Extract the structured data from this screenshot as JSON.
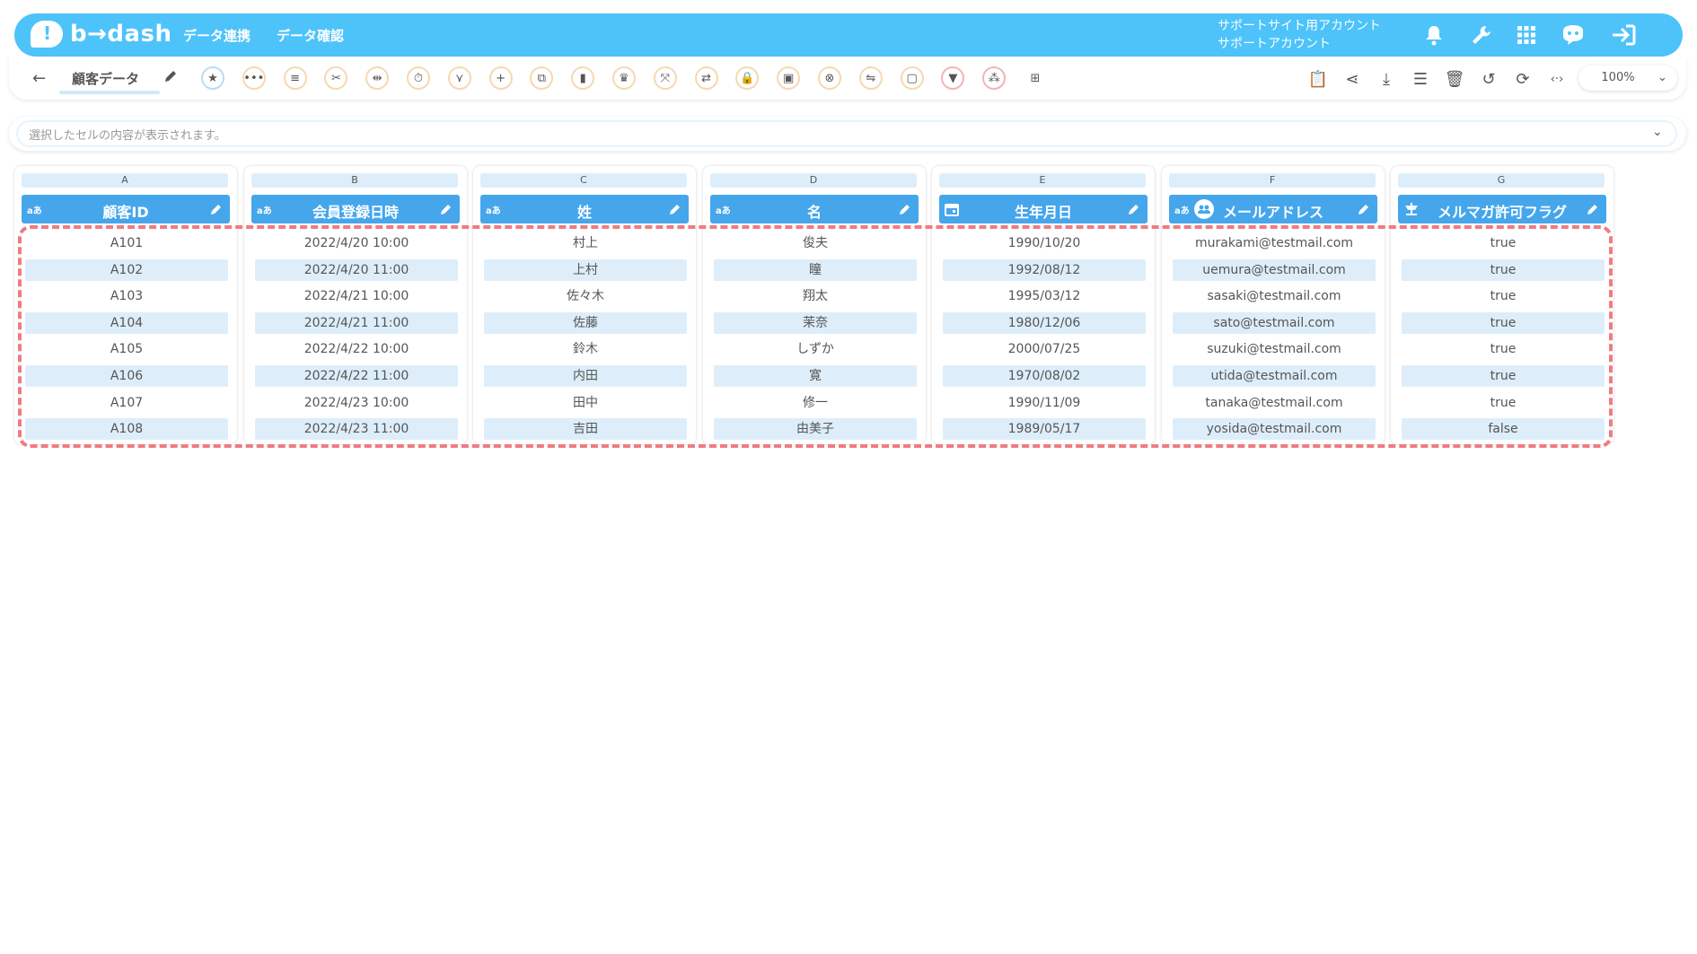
{
  "header": {
    "brand": "b→dash",
    "logo_mark": "!",
    "nav": [
      "データ連携",
      "データ確認"
    ],
    "account_line1": "サポートサイト用アカウント",
    "account_line2": "サポートアカウント",
    "icons": [
      "bell-icon",
      "wrench-icon",
      "apps-grid-icon",
      "chat-bot-icon",
      "logout-icon"
    ]
  },
  "toolbar": {
    "back_icon": "←",
    "sheet_name": "顧客データ",
    "tools": [
      {
        "name": "favorite-star-icon",
        "glyph": "★",
        "style": "blue"
      },
      {
        "name": "more-icon",
        "glyph": "•••",
        "style": "orange"
      },
      {
        "name": "rows-icon",
        "glyph": "≡",
        "style": "orange"
      },
      {
        "name": "split-icon",
        "glyph": "✂",
        "style": "orange"
      },
      {
        "name": "remove-column-icon",
        "glyph": "⇹",
        "style": "orange"
      },
      {
        "name": "timer-icon",
        "glyph": "⏱",
        "style": "orange"
      },
      {
        "name": "merge-icon",
        "glyph": "⋎",
        "style": "orange"
      },
      {
        "name": "add-icon",
        "glyph": "+",
        "style": "orange"
      },
      {
        "name": "copy-icon",
        "glyph": "⧉",
        "style": "orange"
      },
      {
        "name": "delete-icon",
        "glyph": "▮",
        "style": "orange"
      },
      {
        "name": "crown-icon",
        "glyph": "♛",
        "style": "orange"
      },
      {
        "name": "collapse-icon",
        "glyph": "⤧",
        "style": "orange"
      },
      {
        "name": "convert-icon",
        "glyph": "⇄",
        "style": "orange"
      },
      {
        "name": "lock-icon",
        "glyph": "🔒",
        "style": "orange"
      },
      {
        "name": "box-icon",
        "glyph": "▣",
        "style": "orange"
      },
      {
        "name": "cancel-icon",
        "glyph": "⊗",
        "style": "orange"
      },
      {
        "name": "translate-icon",
        "glyph": "⇋",
        "style": "orange"
      },
      {
        "name": "frame-icon",
        "glyph": "▢",
        "style": "orange"
      },
      {
        "name": "filter-icon",
        "glyph": "▼",
        "style": "red"
      },
      {
        "name": "pivot-icon",
        "glyph": "⁂",
        "style": "red"
      },
      {
        "name": "table-icon",
        "glyph": "⊞",
        "style": "plain"
      }
    ],
    "right_icons": [
      {
        "name": "clipboard-icon",
        "glyph": "📋"
      },
      {
        "name": "share-icon",
        "glyph": "⋖"
      },
      {
        "name": "download-icon",
        "glyph": "⤓"
      },
      {
        "name": "list-view-icon",
        "glyph": "☰"
      },
      {
        "name": "trash-icon",
        "glyph": "🗑"
      },
      {
        "name": "history-icon",
        "glyph": "↺"
      },
      {
        "name": "refresh-icon",
        "glyph": "⟳"
      },
      {
        "name": "code-icon",
        "glyph": "‹·›"
      }
    ],
    "zoom": "100%"
  },
  "cellbar": {
    "placeholder": "選択したセルの内容が表示されます。",
    "chevron": "⌄"
  },
  "columns": [
    {
      "letter": "A",
      "type": "aあ",
      "name": "顧客ID",
      "cells": [
        "A101",
        "A102",
        "A103",
        "A104",
        "A105",
        "A106",
        "A107",
        "A108"
      ]
    },
    {
      "letter": "B",
      "type": "aあ",
      "name": "会員登録日時",
      "cells": [
        "2022/4/20 10:00",
        "2022/4/20 11:00",
        "2022/4/21 10:00",
        "2022/4/21 11:00",
        "2022/4/22 10:00",
        "2022/4/22 11:00",
        "2022/4/23 10:00",
        "2022/4/23 11:00"
      ]
    },
    {
      "letter": "C",
      "type": "aあ",
      "name": "姓",
      "cells": [
        "村上",
        "上村",
        "佐々木",
        "佐藤",
        "鈴木",
        "内田",
        "田中",
        "吉田"
      ]
    },
    {
      "letter": "D",
      "type": "aあ",
      "name": "名",
      "cells": [
        "俊夫",
        "瞳",
        "翔太",
        "茉奈",
        "しずか",
        "寛",
        "修一",
        "由美子"
      ]
    },
    {
      "letter": "E",
      "type": "calendar",
      "name": "生年月日",
      "cells": [
        "1990/10/20",
        "1992/08/12",
        "1995/03/12",
        "1980/12/06",
        "2000/07/25",
        "1970/08/02",
        "1990/11/09",
        "1989/05/17"
      ]
    },
    {
      "letter": "F",
      "type": "aあ",
      "name": "メールアドレス",
      "cells": [
        "murakami@testmail.com",
        "uemura@testmail.com",
        "sasaki@testmail.com",
        "sato@testmail.com",
        "suzuki@testmail.com",
        "utida@testmail.com",
        "tanaka@testmail.com",
        "yosida@testmail.com"
      ]
    },
    {
      "letter": "G",
      "type": "flag",
      "name": "メルマガ許可フラグ",
      "cells": [
        "true",
        "true",
        "true",
        "true",
        "true",
        "true",
        "true",
        "false"
      ]
    }
  ]
}
